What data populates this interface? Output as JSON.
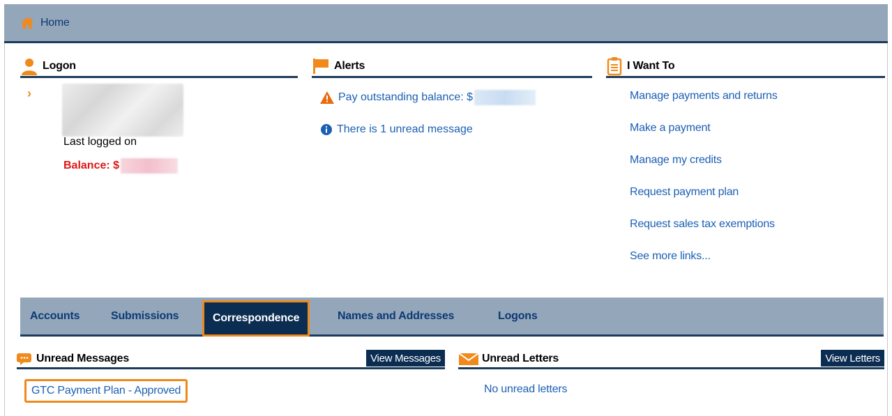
{
  "header": {
    "home_label": "Home"
  },
  "logon": {
    "title": "Logon",
    "last_logged": "Last logged on",
    "balance_label": "Balance: $"
  },
  "alerts": {
    "title": "Alerts",
    "items": [
      {
        "text": "Pay outstanding balance: $",
        "icon": "warning-icon"
      },
      {
        "text": "There is 1 unread message",
        "icon": "info-icon"
      }
    ]
  },
  "i_want_to": {
    "title": "I Want To",
    "links": [
      "Manage payments and returns",
      "Make a payment",
      "Manage my credits",
      "Request payment plan",
      "Request sales tax exemptions",
      "See more links..."
    ]
  },
  "tabs": {
    "items": [
      "Accounts",
      "Submissions",
      "Correspondence",
      "Names and Addresses",
      "Logons"
    ],
    "active": "Correspondence"
  },
  "unread_messages": {
    "title": "Unread Messages",
    "button": "View Messages",
    "items": [
      "GTC Payment Plan - Approved"
    ]
  },
  "unread_letters": {
    "title": "Unread Letters",
    "button": "View Letters",
    "empty_text": "No unread letters"
  },
  "colors": {
    "header_bg": "#94a6ba",
    "navy": "#1b3a5c",
    "link": "#1b5fb4",
    "accent_orange": "#ee8a1c",
    "balance_red": "#e01616"
  }
}
